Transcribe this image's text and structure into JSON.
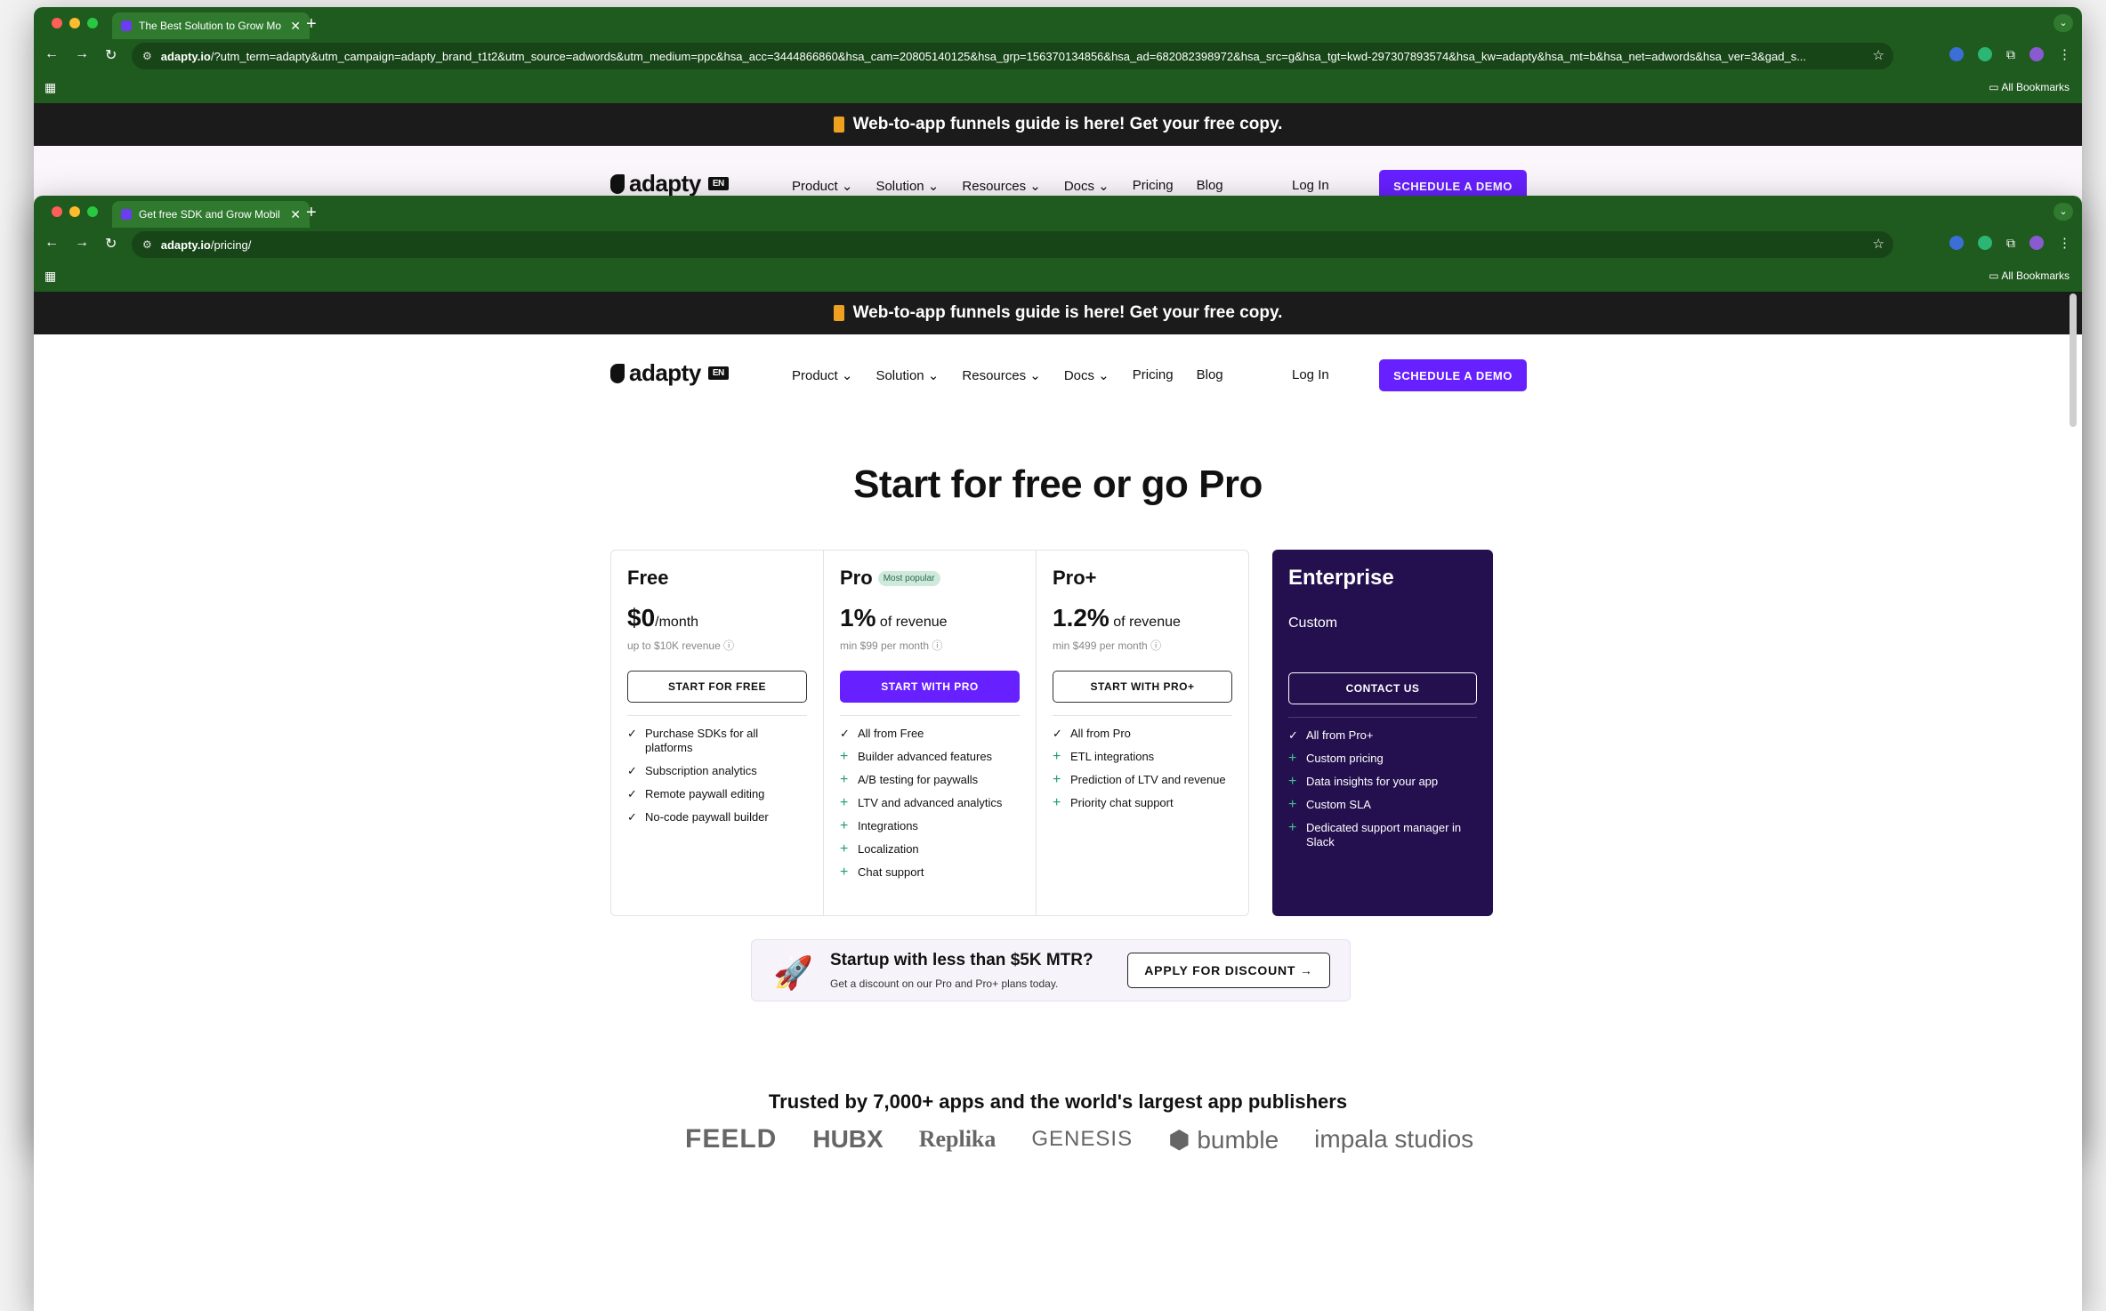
{
  "colors": {
    "accent": "#6720ff",
    "chrome": "#1f5a1f",
    "enterprise_bg": "#24104f",
    "banner_bg": "#1b1b1b"
  },
  "back_window": {
    "tab_title": "The Best Solution to Grow Mo",
    "url_host": "adapty.io",
    "url_rest": "/?utm_term=adapty&utm_campaign=adapty_brand_t1t2&utm_source=adwords&utm_medium=ppc&hsa_acc=3444866860&hsa_cam=20805140125&hsa_grp=156370134856&hsa_ad=682082398972&hsa_src=g&hsa_tgt=kwd-297307893574&hsa_kw=adapty&hsa_mt=b&hsa_net=adwords&hsa_ver=3&gad_s...",
    "all_bookmarks": "All Bookmarks"
  },
  "front_window": {
    "tab_title": "Get free SDK and Grow Mobil",
    "url_host": "adapty.io",
    "url_rest": "/pricing/",
    "all_bookmarks": "All Bookmarks"
  },
  "banner": "Web-to-app funnels guide is here! Get your free copy.",
  "nav": {
    "logo": "adapty",
    "lang": "EN",
    "items": [
      "Product ⌄",
      "Solution ⌄",
      "Resources ⌄",
      "Docs ⌄",
      "Pricing",
      "Blog"
    ],
    "login": "Log In",
    "demo": "SCHEDULE A DEMO"
  },
  "hero_title": "Start for free or go Pro",
  "plans": [
    {
      "name": "Free",
      "badge": "",
      "price": "$0",
      "unit": "/month",
      "note": "up to $10K revenue ⓘ",
      "button": "START FOR FREE",
      "features": [
        {
          "icon": "✓",
          "text": "Purchase SDKs for all platforms"
        },
        {
          "icon": "✓",
          "text": "Subscription analytics"
        },
        {
          "icon": "✓",
          "text": "Remote paywall editing"
        },
        {
          "icon": "✓",
          "text": "No-code paywall builder"
        }
      ]
    },
    {
      "name": "Pro",
      "badge": "Most popular",
      "price": "1%",
      "unit": " of revenue",
      "note": "min $99 per month ⓘ",
      "button": "START WITH PRO",
      "features": [
        {
          "icon": "✓",
          "text": "All from Free"
        },
        {
          "icon": "+",
          "text": "Builder advanced features"
        },
        {
          "icon": "+",
          "text": "A/B testing for paywalls"
        },
        {
          "icon": "+",
          "text": "LTV and advanced analytics"
        },
        {
          "icon": "+",
          "text": "Integrations"
        },
        {
          "icon": "+",
          "text": "Localization"
        },
        {
          "icon": "+",
          "text": "Chat support"
        }
      ]
    },
    {
      "name": "Pro+",
      "badge": "",
      "price": "1.2%",
      "unit": " of revenue",
      "note": "min $499 per month ⓘ",
      "button": "START WITH PRO+",
      "features": [
        {
          "icon": "✓",
          "text": "All from Pro"
        },
        {
          "icon": "+",
          "text": "ETL integrations"
        },
        {
          "icon": "+",
          "text": "Prediction of LTV and revenue"
        },
        {
          "icon": "+",
          "text": "Priority chat support"
        }
      ]
    }
  ],
  "enterprise": {
    "name": "Enterprise",
    "price": "Custom",
    "button": "CONTACT US",
    "features": [
      {
        "icon": "✓",
        "text": "All from Pro+"
      },
      {
        "icon": "+",
        "text": "Custom pricing"
      },
      {
        "icon": "+",
        "text": "Data insights for your app"
      },
      {
        "icon": "+",
        "text": "Custom SLA"
      },
      {
        "icon": "+",
        "text": "Dedicated support manager in Slack"
      }
    ]
  },
  "startup": {
    "title": "Startup with less than $5K MTR?",
    "subtitle": "Get a discount on our Pro and Pro+ plans today.",
    "button": "APPLY FOR DISCOUNT →"
  },
  "trusted": "Trusted by 7,000+ apps and the world's largest app publishers",
  "logos": [
    "FEELD",
    "HUBX",
    "Replika",
    "GENESIS",
    "bumble",
    "impala studios"
  ]
}
